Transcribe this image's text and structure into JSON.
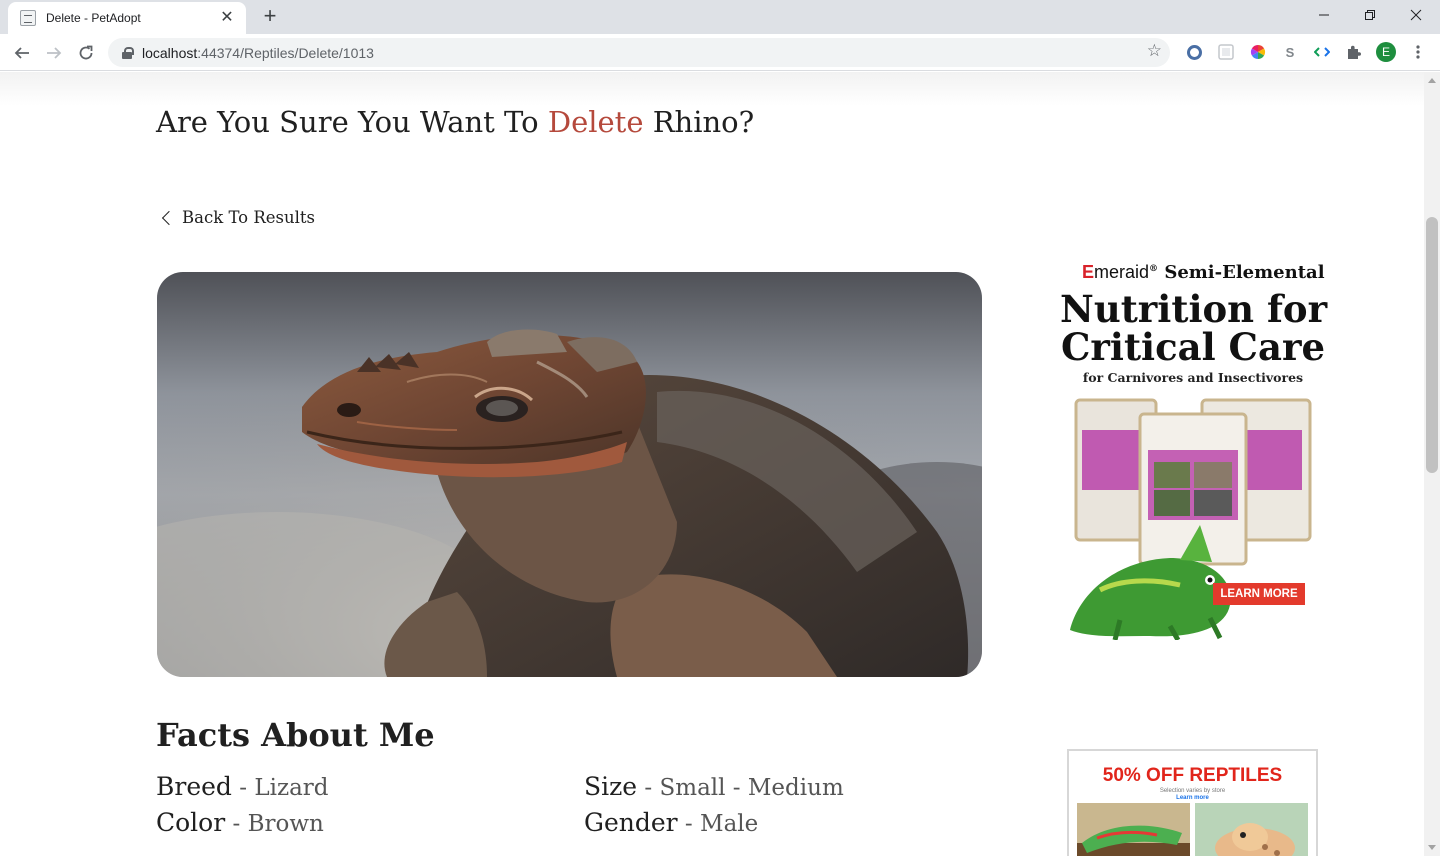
{
  "browser": {
    "tab_title": "Delete - PetAdopt",
    "url_host": "localhost",
    "url_rest": ":44374/Reptiles/Delete/1013",
    "profile_initial": "E",
    "extension_s_label": "S"
  },
  "page": {
    "heading_before": "Are You Sure You Want To ",
    "heading_accent": "Delete",
    "heading_after": " Rhino?",
    "back_link": "Back To Results",
    "facts_title": "Facts About Me",
    "facts": [
      {
        "label": "Breed",
        "value": "Lizard"
      },
      {
        "label": "Size",
        "value": "Small - Medium"
      },
      {
        "label": "Color",
        "value": "Brown"
      },
      {
        "label": "Gender",
        "value": "Male"
      }
    ],
    "separator": " - "
  },
  "ads": {
    "ad1": {
      "brand_first_letter": "E",
      "brand_rest": "meraid",
      "brand_mark": "®",
      "brand_tagline": " Semi-Elemental",
      "headline_1": "Nutrition for",
      "headline_2": "Critical Care",
      "subline": "for Carnivores and Insectivores",
      "cta": "LEARN MORE"
    },
    "ad2": {
      "headline": "50% OFF REPTILES",
      "fine_print": "Selection varies by store",
      "link": "Learn more"
    }
  },
  "colors": {
    "accent": "#b5493c",
    "ad_red": "#e33a2c",
    "profile": "#1e8e3e"
  }
}
